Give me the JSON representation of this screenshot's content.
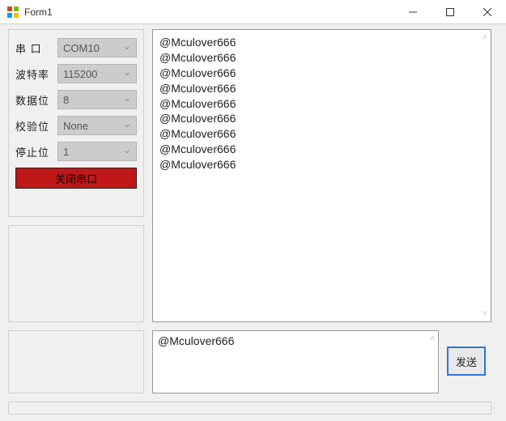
{
  "window": {
    "title": "Form1"
  },
  "config": {
    "rows": [
      {
        "label": "串  口",
        "value": "COM10"
      },
      {
        "label": "波特率",
        "value": "115200"
      },
      {
        "label": "数据位",
        "value": "8"
      },
      {
        "label": "校验位",
        "value": "None"
      },
      {
        "label": "停止位",
        "value": "1"
      }
    ],
    "close_port_label": "关闭串口"
  },
  "receive": {
    "lines": [
      "@Mculover666",
      "@Mculover666",
      "@Mculover666",
      "@Mculover666",
      "@Mculover666",
      "@Mculover666",
      "@Mculover666",
      "@Mculover666",
      "@Mculover666"
    ]
  },
  "send": {
    "text": "@Mculover666",
    "button_label": "发送"
  }
}
